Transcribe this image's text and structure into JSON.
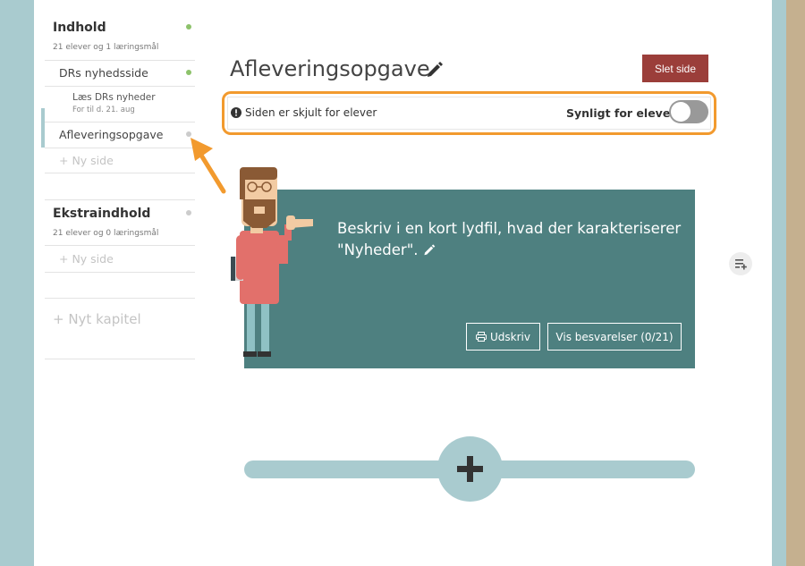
{
  "sidebar": {
    "sections": [
      {
        "title": "Indhold",
        "subtitle": "21 elever og 1 læringsmål",
        "status_color": "#8dc26b",
        "pages": [
          {
            "label": "DRs nyhedsside",
            "status_color": "#8dc26b",
            "subitem": {
              "title": "Læs DRs nyheder",
              "date": "For til d. 21. aug"
            }
          },
          {
            "label": "Afleveringsopgave",
            "status_color": "#cccccc",
            "active": true
          }
        ],
        "new_page": "+ Ny side"
      },
      {
        "title": "Ekstraindhold",
        "subtitle": "21 elever og 0 læringsmål",
        "status_color": "#cccccc",
        "new_page": "+ Ny side"
      }
    ],
    "new_chapter": "+ Nyt kapitel"
  },
  "page": {
    "title": "Afleveringsopgave",
    "delete_label": "Slet side"
  },
  "visibility": {
    "hidden_text": "Siden er skjult for elever",
    "toggle_label": "Synligt for elever",
    "visible": false
  },
  "task": {
    "text": "Beskriv i en kort lydfil, hvad der karakteriserer \"Nyheder\".",
    "print_label": "Udskriv",
    "answers_label": "Vis besvarelser (0/21)"
  },
  "colors": {
    "accent": "#f29a2e",
    "danger": "#9b3e3a",
    "card": "#4e8080",
    "frame": "#a9cbcf"
  }
}
